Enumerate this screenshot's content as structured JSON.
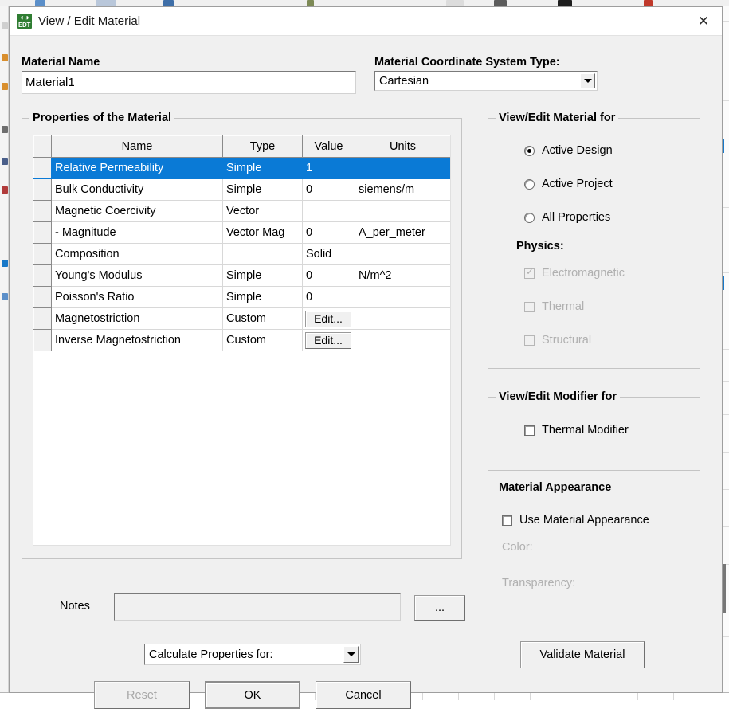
{
  "window": {
    "title": "View / Edit Material",
    "app_icon": "edt-globe-icon",
    "app_icon_text": "EDT",
    "close_glyph": "✕"
  },
  "material_name": {
    "label": "Material Name",
    "value": "Material1"
  },
  "coord_system": {
    "label": "Material Coordinate System Type:",
    "value": "Cartesian"
  },
  "properties": {
    "group_title": "Properties of the Material",
    "columns": [
      "",
      "Name",
      "Type",
      "Value",
      "Units"
    ],
    "rows": [
      {
        "name": "Relative Permeability",
        "type": "Simple",
        "value": "1",
        "units": "",
        "selected": true,
        "value_is_button": false
      },
      {
        "name": "Bulk Conductivity",
        "type": "Simple",
        "value": "0",
        "units": "siemens/m",
        "selected": false,
        "value_is_button": false
      },
      {
        "name": "Magnetic Coercivity",
        "type": "Vector",
        "value": "",
        "units": "",
        "selected": false,
        "value_is_button": false
      },
      {
        "name": "-  Magnitude",
        "type": "Vector Mag",
        "value": "0",
        "units": "A_per_meter",
        "selected": false,
        "value_is_button": false
      },
      {
        "name": "Composition",
        "type": "",
        "value": "Solid",
        "units": "",
        "selected": false,
        "value_is_button": false
      },
      {
        "name": "Young's Modulus",
        "type": "Simple",
        "value": "0",
        "units": "N/m^2",
        "selected": false,
        "value_is_button": false
      },
      {
        "name": "Poisson's Ratio",
        "type": "Simple",
        "value": "0",
        "units": "",
        "selected": false,
        "value_is_button": false
      },
      {
        "name": "Magnetostriction",
        "type": "Custom",
        "value": "Edit...",
        "units": "",
        "selected": false,
        "value_is_button": true
      },
      {
        "name": "Inverse Magnetostriction",
        "type": "Custom",
        "value": "Edit...",
        "units": "",
        "selected": false,
        "value_is_button": true
      }
    ]
  },
  "notes": {
    "label": "Notes",
    "value": "",
    "browse_label": "..."
  },
  "calculate": {
    "value": "Calculate Properties for:"
  },
  "buttons": {
    "reset": "Reset",
    "ok": "OK",
    "cancel": "Cancel",
    "validate": "Validate Material"
  },
  "view_edit_for": {
    "group_title": "View/Edit Material for",
    "options": [
      {
        "label": "Active Design",
        "selected": true
      },
      {
        "label": "Active Project",
        "selected": false
      },
      {
        "label": "All Properties",
        "selected": false
      }
    ],
    "physics_label": "Physics:",
    "physics": [
      {
        "label": "Electromagnetic",
        "checked": true,
        "disabled": true
      },
      {
        "label": "Thermal",
        "checked": false,
        "disabled": true
      },
      {
        "label": "Structural",
        "checked": false,
        "disabled": true
      }
    ]
  },
  "modifier": {
    "group_title": "View/Edit Modifier for",
    "thermal_modifier": {
      "label": "Thermal Modifier",
      "checked": false
    }
  },
  "appearance": {
    "group_title": "Material Appearance",
    "use": {
      "label": "Use Material Appearance",
      "checked": false
    },
    "color_label": "Color:",
    "transparency_label": "Transparency:"
  },
  "colors": {
    "selection": "#0a7ad6",
    "dialog_bg": "#f0f0f0",
    "icon_green": "#2f7d32",
    "disabled_text": "#b0b0b0"
  }
}
